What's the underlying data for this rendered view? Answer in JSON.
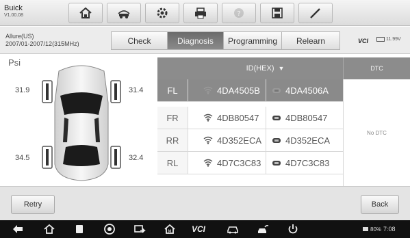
{
  "header": {
    "brand": "Buick",
    "version": "V1.00.08",
    "toolbar": [
      {
        "name": "home-icon",
        "enabled": true
      },
      {
        "name": "vehicle-swap-icon",
        "enabled": true
      },
      {
        "name": "settings-icon",
        "enabled": true
      },
      {
        "name": "print-icon",
        "enabled": true
      },
      {
        "name": "help-icon",
        "enabled": false
      },
      {
        "name": "save-icon",
        "enabled": true
      },
      {
        "name": "pen-icon",
        "enabled": true
      }
    ]
  },
  "subheader": {
    "vehicle_line1": "Allure(US)",
    "vehicle_line2": "2007/01-2007/12(315MHz)",
    "tabs": [
      {
        "label": "Check",
        "active": false
      },
      {
        "label": "Diagnosis",
        "active": true
      },
      {
        "label": "Programming",
        "active": false
      },
      {
        "label": "Relearn",
        "active": false
      }
    ],
    "vci_label": "VCI",
    "battery_voltage": "11.99V"
  },
  "pressure": {
    "unit": "Psi",
    "front_left": "31.9",
    "front_right": "31.4",
    "rear_left": "34.5",
    "rear_right": "32.4"
  },
  "table": {
    "id_header": "ID(HEX)",
    "dtc_header": "DTC",
    "dtc_value": "No DTC",
    "rows": [
      {
        "pos": "FL",
        "sensor_id": "4DA4505B",
        "ecu_id": "4DA4506A",
        "selected": true
      },
      {
        "pos": "FR",
        "sensor_id": "4DB80547",
        "ecu_id": "4DB80547",
        "selected": false
      },
      {
        "pos": "RR",
        "sensor_id": "4D352ECA",
        "ecu_id": "4D352ECA",
        "selected": false
      },
      {
        "pos": "RL",
        "sensor_id": "4D7C3C83",
        "ecu_id": "4D7C3C83",
        "selected": false
      }
    ]
  },
  "actions": {
    "retry_label": "Retry",
    "back_label": "Back"
  },
  "navbar": {
    "vci_label": "VCI",
    "battery_percent": "80%",
    "time": "7:08"
  }
}
